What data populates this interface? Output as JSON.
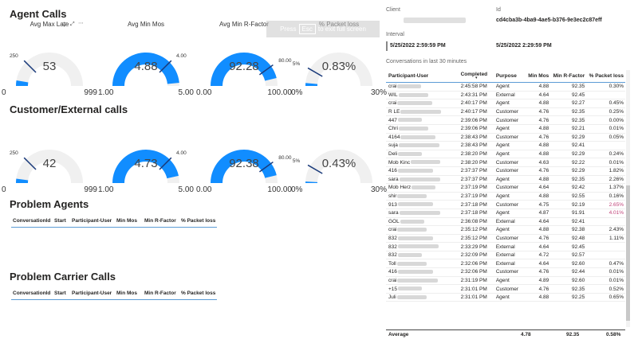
{
  "sections": {
    "agent": "Agent Calls",
    "customer": "Customer/External calls",
    "problem_agents": "Problem Agents",
    "problem_carrier": "Problem Carrier Calls"
  },
  "agent_gauges": [
    {
      "title": "Avg Max Late",
      "value": "53",
      "min": "0",
      "max": "999",
      "target": "250",
      "fill": 0.053,
      "target_frac": 0.25
    },
    {
      "title": "Avg Min Mos",
      "value": "4.88",
      "min": "1.00",
      "max": "5.00",
      "target": "4.00",
      "fill": 0.97,
      "target_frac": 0.75
    },
    {
      "title": "Avg Min R-Factor",
      "value": "92.28",
      "min": "0.00",
      "max": "100.00",
      "target": "80.00",
      "fill": 0.923,
      "target_frac": 0.8
    },
    {
      "title": "% Packet loss",
      "value": "0.83%",
      "min": "0%",
      "max": "30%",
      "target": "5%",
      "fill": 0.028,
      "target_frac": 0.167
    }
  ],
  "customer_gauges": [
    {
      "title": "",
      "value": "42",
      "min": "0",
      "max": "999",
      "target": "250",
      "fill": 0.042,
      "target_frac": 0.25
    },
    {
      "title": "",
      "value": "4.73",
      "min": "1.00",
      "max": "5.00",
      "target": "4.00",
      "fill": 0.93,
      "target_frac": 0.75
    },
    {
      "title": "",
      "value": "92.38",
      "min": "0.00",
      "max": "100.00",
      "target": "80.00",
      "fill": 0.924,
      "target_frac": 0.8
    },
    {
      "title": "",
      "value": "0.43%",
      "min": "0%",
      "max": "30%",
      "target": "5%",
      "fill": 0.014,
      "target_frac": 0.167
    }
  ],
  "problem_headers": [
    "ConversationId",
    "Start",
    "Participant-User",
    "Min Mos",
    "Min R-Factor",
    "% Packet loss"
  ],
  "overlay": {
    "press": "Press",
    "key": "Esc",
    "rest": "to exit full screen"
  },
  "info": {
    "client_label": "Client",
    "id_label": "Id",
    "id_value": "cd4cba3b-4ba9-4ae5-b376-9e3ec2c87eff",
    "interval_label": "Interval",
    "interval_start": "5/25/2022 2:59:59 PM",
    "interval_end": "5/25/2022 2:29:59 PM"
  },
  "conv": {
    "title": "Conversations in last 30 minutes",
    "headers": [
      "Participant-User",
      "Completed",
      "Purpose",
      "Min Mos",
      "Min R-Factor",
      "% Packet loss"
    ],
    "rows": [
      [
        "crai",
        "2:45:58 PM",
        "Agent",
        "4.88",
        "92.35",
        "0.30%"
      ],
      [
        "WIL",
        "2:43:31 PM",
        "External",
        "4.64",
        "92.45",
        ""
      ],
      [
        "crai",
        "2:40:17 PM",
        "Agent",
        "4.88",
        "92.27",
        "0.45%"
      ],
      [
        "R LE",
        "2:40:17 PM",
        "Customer",
        "4.76",
        "92.35",
        "0.25%"
      ],
      [
        "447",
        "2:39:06 PM",
        "Customer",
        "4.76",
        "92.35",
        "0.00%"
      ],
      [
        "Chri",
        "2:39:06 PM",
        "Agent",
        "4.88",
        "92.21",
        "0.01%"
      ],
      [
        "4164",
        "2:38:43 PM",
        "Customer",
        "4.76",
        "92.29",
        "0.05%"
      ],
      [
        "suja",
        "2:38:43 PM",
        "Agent",
        "4.88",
        "92.41",
        ""
      ],
      [
        "Deli",
        "2:38:20 PM",
        "Agent",
        "4.88",
        "92.29",
        "0.24%"
      ],
      [
        "Mob Kinc",
        "2:38:20 PM",
        "Customer",
        "4.63",
        "92.22",
        "0.01%"
      ],
      [
        "416",
        "2:37:37 PM",
        "Customer",
        "4.76",
        "92.29",
        "1.82%"
      ],
      [
        "sara",
        "2:37:37 PM",
        "Agent",
        "4.88",
        "92.35",
        "2.26%"
      ],
      [
        "Mob Herz",
        "2:37:19 PM",
        "Customer",
        "4.64",
        "92.42",
        "1.37%"
      ],
      [
        "shir",
        "2:37:19 PM",
        "Agent",
        "4.88",
        "92.55",
        "0.16%"
      ],
      [
        "913",
        "2:37:18 PM",
        "Customer",
        "4.75",
        "92.19",
        "2.65%"
      ],
      [
        "sara",
        "2:37:18 PM",
        "Agent",
        "4.87",
        "91.91",
        "4.01%"
      ],
      [
        "GOL",
        "2:36:08 PM",
        "External",
        "4.64",
        "92.41",
        ""
      ],
      [
        "crai",
        "2:35:12 PM",
        "Agent",
        "4.88",
        "92.38",
        "2.43%"
      ],
      [
        "832",
        "2:35:12 PM",
        "Customer",
        "4.76",
        "92.48",
        "1.11%"
      ],
      [
        "832",
        "2:33:29 PM",
        "External",
        "4.64",
        "92.45",
        ""
      ],
      [
        "832",
        "2:32:09 PM",
        "External",
        "4.72",
        "92.57",
        ""
      ],
      [
        "Toll",
        "2:32:06 PM",
        "External",
        "4.64",
        "92.60",
        "0.47%"
      ],
      [
        "416",
        "2:32:06 PM",
        "Customer",
        "4.76",
        "92.44",
        "0.01%"
      ],
      [
        "crai",
        "2:31:19 PM",
        "Agent",
        "4.89",
        "92.60",
        "0.01%"
      ],
      [
        "+15",
        "2:31:01 PM",
        "Customer",
        "4.76",
        "92.35",
        "0.52%"
      ],
      [
        "Juli",
        "2:31:01 PM",
        "Agent",
        "4.88",
        "92.25",
        "0.65%"
      ]
    ],
    "footer": {
      "label": "Average",
      "mos": "4.78",
      "rfactor": "92.35",
      "loss": "0.58%"
    }
  },
  "colors": {
    "accent": "#118dff",
    "track": "#f0f0f0",
    "target": "#1a3a7a",
    "header_line": "#5b9bd5",
    "warn": "#c1447a"
  }
}
